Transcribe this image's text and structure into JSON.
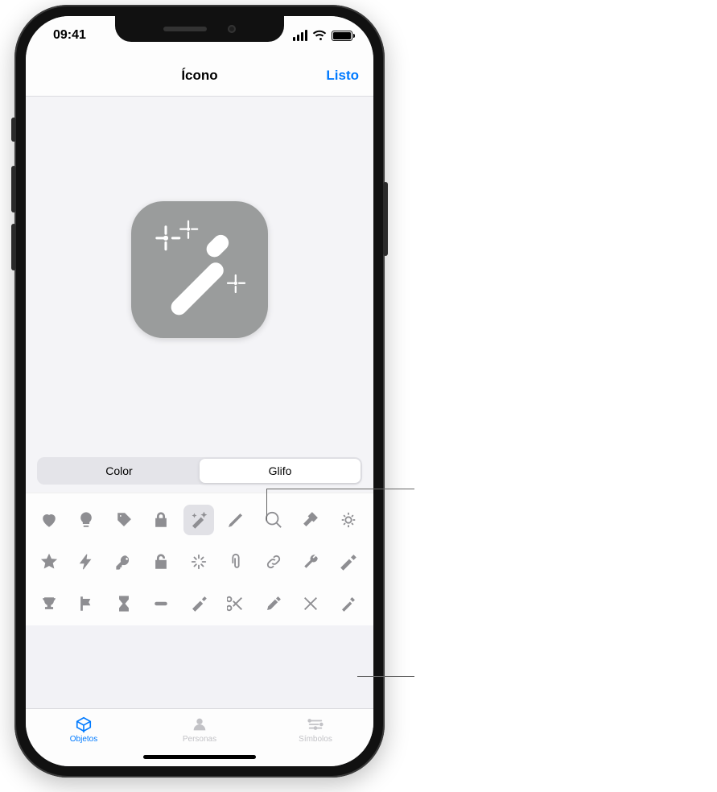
{
  "status": {
    "time": "09:41"
  },
  "nav": {
    "title": "Ícono",
    "done_label": "Listo"
  },
  "segmented": {
    "options": [
      "Color",
      "Glifo"
    ],
    "active_index": 1
  },
  "preview": {
    "glyph_name": "magic-wand",
    "background_color": "#9a9c9c"
  },
  "glyphs": {
    "selected_index": 4,
    "items": [
      "heart",
      "lightbulb",
      "tag",
      "lock",
      "magic-wand",
      "pencil",
      "magnifying-glass",
      "hammer",
      "gear",
      "star",
      "bolt",
      "key",
      "lock-open",
      "sparkle",
      "paperclip",
      "link",
      "wrench",
      "hammer-2",
      "trophy",
      "flag",
      "hourglass",
      "minus",
      "paint-roller",
      "scissors",
      "eyedropper",
      "tools",
      "screwdriver"
    ]
  },
  "tabs": {
    "active_index": 0,
    "items": [
      {
        "name": "objects",
        "label": "Objetos"
      },
      {
        "name": "people",
        "label": "Personas"
      },
      {
        "name": "symbols",
        "label": "Símbolos"
      }
    ]
  }
}
